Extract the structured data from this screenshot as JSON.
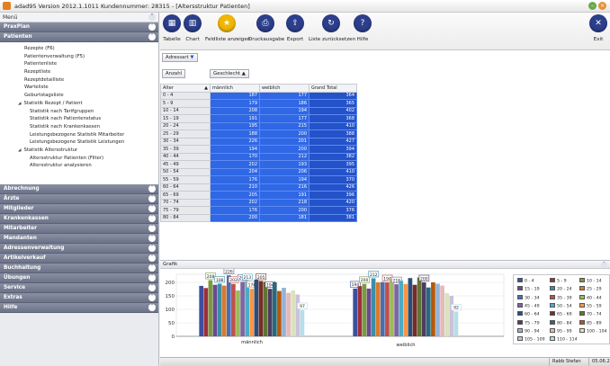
{
  "window": {
    "title": "adad95  Version 2012.1.1011  Kundennummer: 28315 - [Altersstruktur Patienten]"
  },
  "sidebar": {
    "menu_label": "Menü",
    "sections_top": [
      "PraxPlan",
      "Patienten"
    ],
    "items": [
      {
        "label": "Rezepte (F6)",
        "level": 0
      },
      {
        "label": "Patientenverwaltung (F5)",
        "level": 0
      },
      {
        "label": "Patientenliste",
        "level": 0
      },
      {
        "label": "Rezeptliste",
        "level": 0
      },
      {
        "label": "Rezeptdetailliste",
        "level": 0
      },
      {
        "label": "Warteliste",
        "level": 0
      },
      {
        "label": "Geburtstagsliste",
        "level": 0
      },
      {
        "label": "Statistik Rezept / Patient",
        "level": 1
      },
      {
        "label": "Statistik nach Tarifgruppen",
        "level": 2
      },
      {
        "label": "Statistik nach Patientenstatus",
        "level": 2
      },
      {
        "label": "Statistik nach Krankenkassen",
        "level": 2
      },
      {
        "label": "Leistungsbezogene Statistik Mitarbeiter",
        "level": 2
      },
      {
        "label": "Leistungsbezogene Statistik Leistungen",
        "level": 2
      },
      {
        "label": "Statistik Altersstruktur",
        "level": 1
      },
      {
        "label": "Altersstruktur Patienten (Filter)",
        "level": 2
      },
      {
        "label": "Altersstruktur analysieren",
        "level": 2
      }
    ],
    "sections_bottom": [
      "Abrechnung",
      "Ärzte",
      "Mitglieder",
      "Krankenkassen",
      "Mitarbeiter",
      "Mandanten",
      "Adressenverwaltung",
      "Artikelverkauf",
      "Buchhaltung",
      "Übungen",
      "Service",
      "Extras",
      "Hilfe"
    ]
  },
  "toolbar": {
    "buttons": [
      {
        "label": "Tabelle",
        "icon": "table-icon",
        "glyph": "▦"
      },
      {
        "label": "Chart",
        "icon": "chart-icon",
        "glyph": "▥"
      },
      {
        "label": "Feldliste anzeigen",
        "icon": "star-icon",
        "glyph": "★"
      },
      {
        "label": "Druckausgabe",
        "icon": "printer-icon",
        "glyph": "⎙"
      },
      {
        "label": "Export",
        "icon": "export-icon",
        "glyph": "⇪"
      },
      {
        "label": "Liste zurücksetzen",
        "icon": "reset-icon",
        "glyph": "↻"
      },
      {
        "label": "Hilfe",
        "icon": "help-icon",
        "glyph": "?"
      }
    ],
    "exit_label": "Exit",
    "exit_glyph": "✕"
  },
  "pivot": {
    "filter_label": "Adressart",
    "count_label": "Anzahl",
    "column_field_label": "Geschlecht",
    "row_field_label": "Alter",
    "sort_glyph": "▲",
    "filter_glyph": "▼",
    "columns": [
      "männlich",
      "weiblich",
      "Grand Total"
    ],
    "rows": [
      {
        "age": "0 - 4",
        "m": 187,
        "w": 177,
        "t": 364
      },
      {
        "age": "5 - 9",
        "m": 179,
        "w": 186,
        "t": 365
      },
      {
        "age": "10 - 14",
        "m": 208,
        "w": 194,
        "t": 402
      },
      {
        "age": "15 - 19",
        "m": 191,
        "w": 177,
        "t": 368
      },
      {
        "age": "20 - 24",
        "m": 195,
        "w": 215,
        "t": 410
      },
      {
        "age": "25 - 29",
        "m": 188,
        "w": 200,
        "t": 388
      },
      {
        "age": "30 - 34",
        "m": 226,
        "w": 201,
        "t": 427
      },
      {
        "age": "35 - 39",
        "m": 194,
        "w": 200,
        "t": 394
      },
      {
        "age": "40 - 44",
        "m": 170,
        "w": 212,
        "t": 382
      },
      {
        "age": "45 - 49",
        "m": 202,
        "w": 193,
        "t": 395
      },
      {
        "age": "50 - 54",
        "m": 204,
        "w": 206,
        "t": 410
      },
      {
        "age": "55 - 59",
        "m": 176,
        "w": 194,
        "t": 370
      },
      {
        "age": "60 - 64",
        "m": 210,
        "w": 216,
        "t": 426
      },
      {
        "age": "65 - 69",
        "m": 205,
        "w": 191,
        "t": 396
      },
      {
        "age": "70 - 74",
        "m": 202,
        "w": 218,
        "t": 420
      },
      {
        "age": "75 - 79",
        "m": 176,
        "w": 200,
        "t": 376
      },
      {
        "age": "80 - 84",
        "m": 200,
        "w": 181,
        "t": 381
      }
    ]
  },
  "grafik": {
    "panel_label": "Grafik"
  },
  "chart_data": {
    "type": "bar",
    "categories": [
      "männlich",
      "weiblich"
    ],
    "ylim": [
      0,
      230
    ],
    "yticks": [
      0,
      50,
      100,
      150,
      200
    ],
    "series": [
      {
        "name": "0 - 4",
        "color": "#3c4f9e",
        "values": [
          187,
          177
        ]
      },
      {
        "name": "5 - 9",
        "color": "#9b2f3c",
        "values": [
          179,
          186
        ]
      },
      {
        "name": "10 - 14",
        "color": "#7a9a3c",
        "values": [
          208,
          194
        ]
      },
      {
        "name": "15 - 19",
        "color": "#6a4a90",
        "values": [
          191,
          177
        ]
      },
      {
        "name": "20 - 24",
        "color": "#3a8ea8",
        "values": [
          195,
          215
        ]
      },
      {
        "name": "25 - 29",
        "color": "#d97a2a",
        "values": [
          188,
          200
        ]
      },
      {
        "name": "30 - 34",
        "color": "#4a6db4",
        "values": [
          226,
          201
        ]
      },
      {
        "name": "35 - 39",
        "color": "#c0504d",
        "values": [
          194,
          200
        ]
      },
      {
        "name": "40 - 44",
        "color": "#9bbb59",
        "values": [
          170,
          212
        ]
      },
      {
        "name": "45 - 49",
        "color": "#8064a2",
        "values": [
          202,
          193
        ]
      },
      {
        "name": "50 - 54",
        "color": "#4bacc6",
        "values": [
          204,
          206
        ]
      },
      {
        "name": "55 - 59",
        "color": "#f79646",
        "values": [
          176,
          194
        ]
      },
      {
        "name": "60 - 64",
        "color": "#2c4d75",
        "values": [
          210,
          216
        ]
      },
      {
        "name": "65 - 69",
        "color": "#772c2a",
        "values": [
          205,
          191
        ]
      },
      {
        "name": "70 - 74",
        "color": "#5f7530",
        "values": [
          202,
          218
        ]
      },
      {
        "name": "75 - 79",
        "color": "#4d3b62",
        "values": [
          176,
          200
        ]
      },
      {
        "name": "80 - 84",
        "color": "#276a7c",
        "values": [
          200,
          181
        ]
      },
      {
        "name": "85 - 89",
        "color": "#b65708",
        "values": [
          168,
          200
        ]
      },
      {
        "name": "90 - 94",
        "color": "#95b3d7",
        "values": [
          180,
          195
        ]
      },
      {
        "name": "95 - 99",
        "color": "#e6b9b8",
        "values": [
          161,
          188
        ]
      },
      {
        "name": "100 - 104",
        "color": "#d7e4bd",
        "values": [
          170,
          160
        ]
      },
      {
        "name": "105 - 109",
        "color": "#ccc1da",
        "values": [
          155,
          150
        ]
      },
      {
        "name": "110 - 114",
        "color": "#b7dee8",
        "values": [
          97,
          92
        ]
      }
    ],
    "data_labels": [
      {
        "series": "10 - 14",
        "category": "männlich",
        "text": "208"
      },
      {
        "series": "20 - 24",
        "category": "männlich",
        "text": "188"
      },
      {
        "series": "30 - 34",
        "category": "männlich",
        "text": "226"
      },
      {
        "series": "35 - 39",
        "category": "männlich",
        "text": "202"
      },
      {
        "series": "45 - 49",
        "category": "männlich",
        "text": "203"
      },
      {
        "series": "50 - 54",
        "category": "männlich",
        "text": "213"
      },
      {
        "series": "55 - 59",
        "category": "männlich",
        "text": "176"
      },
      {
        "series": "65 - 69",
        "category": "männlich",
        "text": "205"
      },
      {
        "series": "75 - 79",
        "category": "männlich",
        "text": "194"
      },
      {
        "series": "110 - 114",
        "category": "männlich",
        "text": "97"
      },
      {
        "series": "0 - 4",
        "category": "weiblich",
        "text": "194"
      },
      {
        "series": "10 - 14",
        "category": "weiblich",
        "text": "200"
      },
      {
        "series": "20 - 24",
        "category": "weiblich",
        "text": "212"
      },
      {
        "series": "35 - 39",
        "category": "weiblich",
        "text": "194"
      },
      {
        "series": "45 - 49",
        "category": "weiblich",
        "text": "218"
      },
      {
        "series": "75 - 79",
        "category": "weiblich",
        "text": "200"
      },
      {
        "series": "110 - 114",
        "category": "weiblich",
        "text": "92"
      }
    ]
  },
  "statusbar": {
    "user": "Rabb Stefan",
    "date": "05.06.20"
  }
}
